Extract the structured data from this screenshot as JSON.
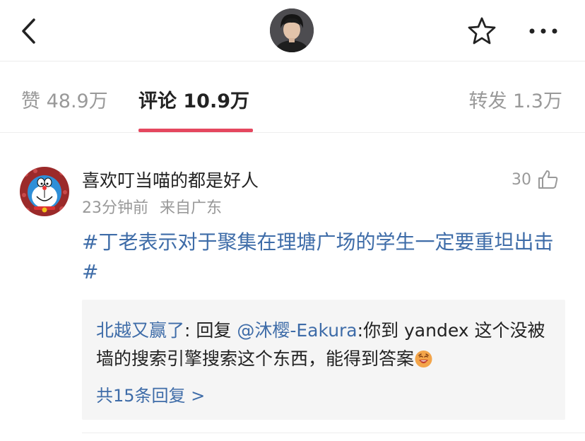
{
  "header": {
    "back_icon": "chevron-left-icon",
    "star_icon": "star-outline-icon",
    "more_icon": "more-horizontal-icon"
  },
  "tabs": [
    {
      "label": "赞 48.9万"
    },
    {
      "label": "评论 10.9万"
    },
    {
      "label": "转发 1.3万"
    }
  ],
  "accent_color": "#e5475f",
  "link_color": "#3e6ca8",
  "comment": {
    "username": "喜欢叮当喵的都是好人",
    "time": "23分钟前",
    "location": "来自广东",
    "like_count": "30",
    "text": "#丁老表示对于聚集在理塘广场的学生一定要重坦出击#",
    "reply": {
      "author": "北越又赢了",
      "sep1": ": 回复 ",
      "mention": "@沐樱-Eakura",
      "content": ":你到 yandex 这个没被墙的搜索引擎搜索这个东西，能得到答案",
      "more_label": "共15条回复 >"
    }
  }
}
